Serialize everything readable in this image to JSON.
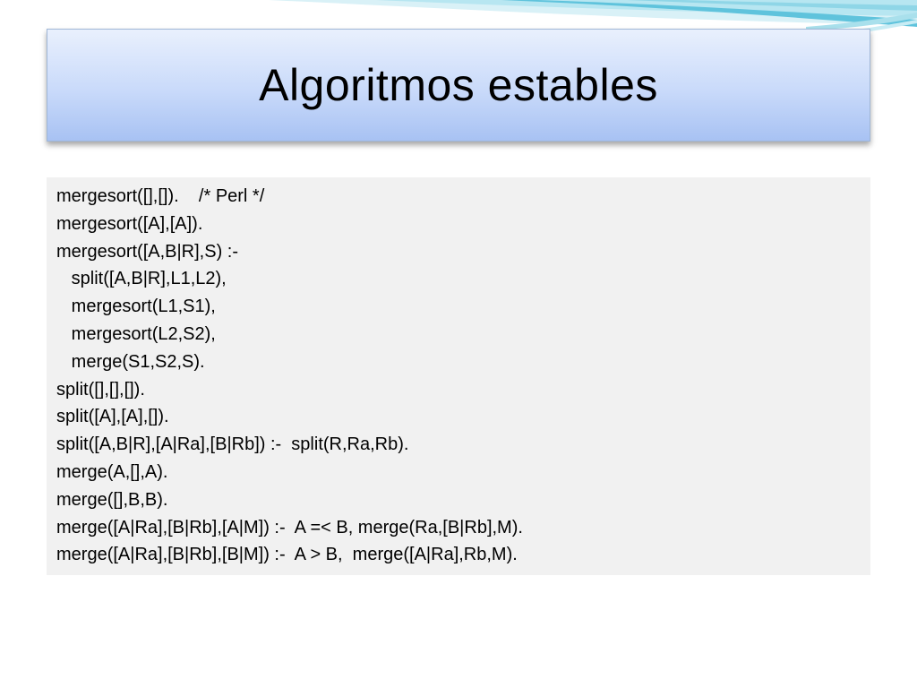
{
  "slide": {
    "title": "Algoritmos estables",
    "code_lines": [
      "mergesort([],[]).    /* Perl */",
      "mergesort([A],[A]).",
      "mergesort([A,B|R],S) :-",
      "   split([A,B|R],L1,L2),",
      "   mergesort(L1,S1),",
      "   mergesort(L2,S2),",
      "   merge(S1,S2,S).",
      "split([],[],[]).",
      "split([A],[A],[]).",
      "split([A,B|R],[A|Ra],[B|Rb]) :-  split(R,Ra,Rb).",
      "merge(A,[],A).",
      "merge([],B,B).",
      "merge([A|Ra],[B|Rb],[A|M]) :-  A =< B, merge(Ra,[B|Rb],M).",
      "merge([A|Ra],[B|Rb],[B|M]) :-  A > B,  merge([A|Ra],Rb,M)."
    ]
  },
  "colors": {
    "title_gradient_top": "#e9f0fd",
    "title_gradient_bottom": "#a8c2f3",
    "code_background": "#f1f1f1",
    "swoosh_blue": "#5fc3dc"
  }
}
